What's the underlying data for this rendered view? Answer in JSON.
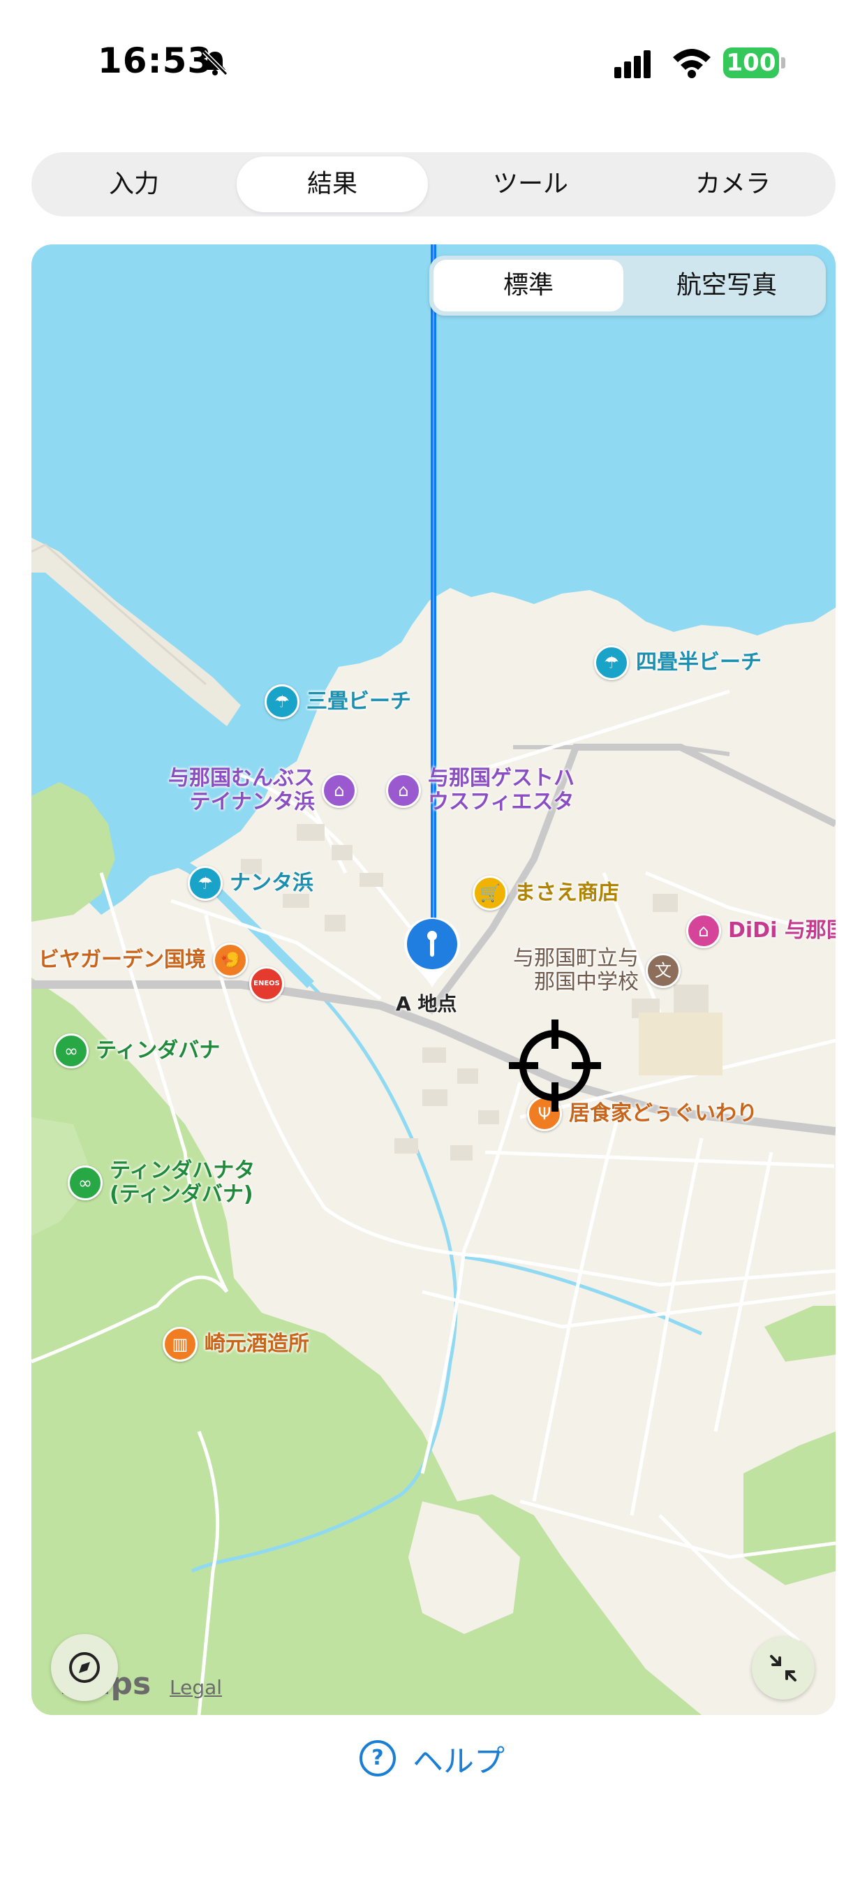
{
  "status_bar": {
    "time": "16:53",
    "battery": "100"
  },
  "tabs": [
    {
      "label": "入力",
      "active": false
    },
    {
      "label": "結果",
      "active": true
    },
    {
      "label": "ツール",
      "active": false
    },
    {
      "label": "カメラ",
      "active": false
    }
  ],
  "map": {
    "toggle": {
      "standard": "標準",
      "aerial": "航空写真",
      "selected": "標準"
    },
    "pin_label": "A 地点",
    "logo": "Maps",
    "legal": "Legal",
    "pois": [
      {
        "label": "四畳半ビーチ",
        "icon": "beach-umbrella-icon",
        "color": "#1aa3c9"
      },
      {
        "label": "三畳ビーチ",
        "icon": "beach-umbrella-icon",
        "color": "#1aa3c9"
      },
      {
        "label": "与那国むんぶス\nテイナンタ浜",
        "icon": "bed-icon",
        "color": "#9b59d0"
      },
      {
        "label": "与那国ゲストハ\nウスフィエスタ",
        "icon": "bed-icon",
        "color": "#9b59d0"
      },
      {
        "label": "ナンタ浜",
        "icon": "beach-umbrella-icon",
        "color": "#1aa3c9"
      },
      {
        "label": "まさえ商店",
        "icon": "cart-icon",
        "color": "#f0b400"
      },
      {
        "label": "DiDi 与那国文",
        "icon": "museum-icon",
        "color": "#d6449a"
      },
      {
        "label": "ビヤガーデン国境",
        "icon": "food-icon",
        "color": "#f07d22"
      },
      {
        "label": "与那国町立与\n那国中学校",
        "icon": "school-icon",
        "color": "#8c6e5a"
      },
      {
        "label": "ENEOS",
        "icon": "gas-station-icon",
        "color": "#e53a2e"
      },
      {
        "label": "ティンダバナ",
        "icon": "binoculars-icon",
        "color": "#27a844"
      },
      {
        "label": "居食家どぅぐいわり",
        "icon": "fork-knife-icon",
        "color": "#f07d22"
      },
      {
        "label": "ティンダハナタ\n(ティンダバナ)",
        "icon": "binoculars-icon",
        "color": "#27a844"
      },
      {
        "label": "崎元酒造所",
        "icon": "barrel-icon",
        "color": "#f07d22"
      }
    ]
  },
  "help": {
    "label": "ヘルプ"
  },
  "colors": {
    "accent": "#1a7fd4",
    "water": "#8fd9f2",
    "land": "#f4f1e8",
    "park": "#bfe2a0",
    "line": "#0a7aff"
  }
}
